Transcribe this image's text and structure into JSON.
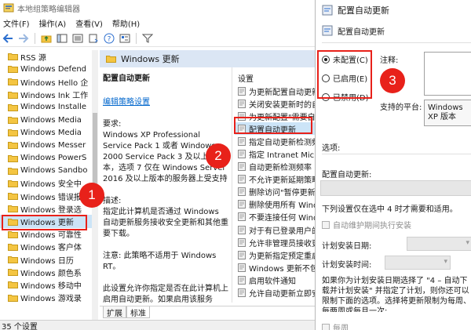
{
  "window": {
    "title": "本地组策略编辑器"
  },
  "menu": [
    "文件(F)",
    "操作(A)",
    "查看(V)",
    "帮助(H)"
  ],
  "tree": {
    "items": [
      {
        "label": "RSS 源",
        "selected": false
      },
      {
        "label": "Windows Defend",
        "selected": false
      },
      {
        "label": "Windows Hello 企",
        "selected": false
      },
      {
        "label": "Windows Ink 工作",
        "selected": false
      },
      {
        "label": "Windows Installe",
        "selected": false
      },
      {
        "label": "Windows Media",
        "selected": false
      },
      {
        "label": "Windows Media",
        "selected": false
      },
      {
        "label": "Windows Messer",
        "selected": false
      },
      {
        "label": "Windows PowerS",
        "selected": false
      },
      {
        "label": "Windows Sandbo",
        "selected": false
      },
      {
        "label": "Windows 安全中",
        "selected": false
      },
      {
        "label": "Windows 错误报",
        "selected": false
      },
      {
        "label": "Windows 登录选",
        "selected": false
      },
      {
        "label": "Windows 更新",
        "selected": true
      },
      {
        "label": "Windows 可靠性",
        "selected": false
      },
      {
        "label": "Windows 客户体",
        "selected": false
      },
      {
        "label": "Windows 日历",
        "selected": false
      },
      {
        "label": "Windows 颜色系",
        "selected": false
      },
      {
        "label": "Windows 移动中",
        "selected": false
      },
      {
        "label": "Windows 游戏录",
        "selected": false
      }
    ]
  },
  "panel": {
    "header": "Windows 更新",
    "desc_title": "配置自动更新",
    "edit_link": "编辑策略设置",
    "req_label": "要求:",
    "req_text": "Windows XP Professional Service Pack 1 或者 Windows 2000 Service Pack 3 及以上版本，选项 7 仅在 Windows Server 2016 及以上版本的服务器上受支持",
    "desc_label": "描述:",
    "desc_text": "指定此计算机是否通过 Windows 自动更新服务接收安全更新和其他重要下载。",
    "note_text": "注意: 此策略不适用于 Windows RT。",
    "more_text": "此设置允许你指定是否在此计算机上启用自动更新。如果启用该服务",
    "settings_header": "设置",
    "settings": [
      {
        "label": "为更新配置自动更新",
        "selected": false
      },
      {
        "label": "关闭安装更新时的自动",
        "selected": false
      },
      {
        "label": "为更新配置\"需要自动",
        "selected": false
      },
      {
        "label": "配置自动更新",
        "selected": true
      },
      {
        "label": "指定自动更新检测频率",
        "selected": false
      },
      {
        "label": "指定 Intranet Micro",
        "selected": false
      },
      {
        "label": "自动更新检测频率",
        "selected": false
      },
      {
        "label": "不允许更新延期策略",
        "selected": false
      },
      {
        "label": "删除访问\"暂停更新\"",
        "selected": false
      },
      {
        "label": "删除使用所有 Windo",
        "selected": false
      },
      {
        "label": "不要连接任何 Windo",
        "selected": false
      },
      {
        "label": "对于有已登录用户的",
        "selected": false
      },
      {
        "label": "允许非管理员接收更新",
        "selected": false
      },
      {
        "label": "为更新指定预定重启",
        "selected": false
      },
      {
        "label": "Windows 更新不包括",
        "selected": false
      },
      {
        "label": "启用软件通知",
        "selected": false
      },
      {
        "label": "允许自动更新立即安装",
        "selected": false
      }
    ],
    "tabs": [
      "扩展",
      "标准"
    ]
  },
  "status": "35 个设置",
  "dialog": {
    "title": "配置自动更新",
    "subtitle": "配置自动更新",
    "radios": [
      {
        "label": "未配置(C)",
        "checked": true
      },
      {
        "label": "已启用(E)",
        "checked": false
      },
      {
        "label": "已禁用(D)",
        "checked": false
      }
    ],
    "comment_label": "注释:",
    "platform_label": "支持的平台:",
    "platform_value": "Windows XP 版本",
    "options_label": "选项:",
    "configure_label": "配置自动更新:",
    "notice": "下列设置仅在选中 4 时才需要和适用。",
    "maintenance_chk": "自动维护期间执行安装",
    "day_label": "计划安装日期:",
    "time_label": "计划安装时间:",
    "long_text": "如果你为计划安装日期选择了 \"4 – 自动下载并计划安装\" 并指定了计划，则你还可以限制下面的选项。选择将更新限制为每周、每两周或每月一次:",
    "weekly_chk": "每周"
  },
  "annotations": [
    "1",
    "2",
    "3"
  ],
  "colors": {
    "accent_red": "#e8211a",
    "selection": "#cce4f7",
    "link": "#0066cc"
  }
}
